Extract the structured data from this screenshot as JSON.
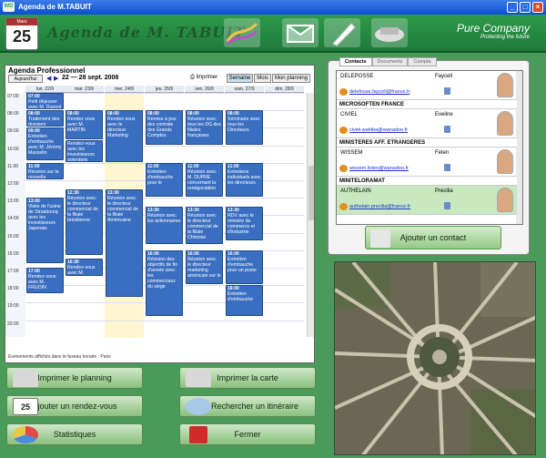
{
  "window": {
    "title": "Agenda de M.TABUIT",
    "icon_label": "WD"
  },
  "header": {
    "calendar_month": "Mars",
    "calendar_day": "25",
    "title": "Agenda de M. TABUIT",
    "brand": "Pure Company",
    "tagline": "Protecting the future"
  },
  "agenda": {
    "title": "Agenda Professionnel",
    "today_label": "Aujourd'hui",
    "range": "22 — 28 sept. 2008",
    "print_label": "Imprimer",
    "views": [
      "Semaine",
      "Mois",
      "Mon planning"
    ],
    "days": [
      "lun. 22/9",
      "mar. 23/9",
      "mer. 24/9",
      "jeu. 25/9",
      "ven. 26/9",
      "sam. 27/9",
      "dim. 28/9"
    ],
    "hours": [
      "07:00",
      "08:00",
      "09:00",
      "10:00",
      "11:00",
      "12:00",
      "13:00",
      "14:00",
      "15:00",
      "16:00",
      "17:00",
      "18:00",
      "19:00",
      "20:00"
    ],
    "events": [
      {
        "day": 0,
        "start": 7,
        "end": 8,
        "time": "07:00",
        "text": "Petit déjeuner avec M. Dupont"
      },
      {
        "day": 0,
        "start": 8,
        "end": 9,
        "time": "08:00",
        "text": "Traitement des dossiers"
      },
      {
        "day": 0,
        "start": 9,
        "end": 10.9,
        "time": "09:00",
        "text": "Entretien d'embauche avec M. Jérémy Masselin"
      },
      {
        "day": 0,
        "start": 11,
        "end": 12,
        "time": "11:00",
        "text": "Réunion sur la nouvelle"
      },
      {
        "day": 0,
        "start": 13,
        "end": 16.8,
        "time": "13:00",
        "text": "Visite de l'usine de Strasbourg avec les investisseurs Japonais"
      },
      {
        "day": 0,
        "start": 17,
        "end": 18.5,
        "time": "17:00",
        "text": "Rendez-vous avec M. FRUOIN"
      },
      {
        "day": 1,
        "start": 8,
        "end": 9.7,
        "time": "08:00",
        "text": "Rendez vous avec M. MARTIN"
      },
      {
        "day": 1,
        "start": 9.7,
        "end": 11,
        "time": "",
        "text": "Rendez-vous avec les investisseurs potentiels"
      },
      {
        "day": 1,
        "start": 12.5,
        "end": 16.3,
        "time": "12:30",
        "text": "Réunion avec le directeur commercial de la filiale brésilienne"
      },
      {
        "day": 1,
        "start": 16.5,
        "end": 17.5,
        "time": "16:30",
        "text": "Rendez-vous avec M."
      },
      {
        "day": 2,
        "start": 8,
        "end": 11,
        "time": "08:00",
        "text": "Rendez-vous avec le directeur Marketing"
      },
      {
        "day": 2,
        "start": 12.5,
        "end": 18.7,
        "time": "13:30",
        "text": "Réunion avec le directeur commercial de la filiale Américaine"
      },
      {
        "day": 3,
        "start": 8,
        "end": 10,
        "time": "08:00",
        "text": "Remise à jour des contrats des Grands Comptes"
      },
      {
        "day": 3,
        "start": 11,
        "end": 13,
        "time": "11:00",
        "text": "Entretien d'embauche pour le"
      },
      {
        "day": 3,
        "start": 13.5,
        "end": 15.7,
        "time": "13:30",
        "text": "Réunion avec les actionnaires"
      },
      {
        "day": 3,
        "start": 16,
        "end": 19.8,
        "time": "16:00",
        "text": "Révision des objectifs de fin d'année avec les commerciaux du siège"
      },
      {
        "day": 4,
        "start": 8,
        "end": 10,
        "time": "08:00",
        "text": "Réunion avec tous les DG des filiales françaises"
      },
      {
        "day": 4,
        "start": 11,
        "end": 13,
        "time": "11:00",
        "text": "Réunion avec M. DUPRE concernant la renégociation"
      },
      {
        "day": 4,
        "start": 13.5,
        "end": 15.7,
        "time": "13:30",
        "text": "Réunion avec le directeur commercial de la filiale Chinoise"
      },
      {
        "day": 4,
        "start": 16,
        "end": 18,
        "time": "16:00",
        "text": "Réunion avec le directeur marketing américain sur le"
      },
      {
        "day": 5,
        "start": 8,
        "end": 10,
        "time": "08:00",
        "text": "Séminaire avec tous les Directeurs"
      },
      {
        "day": 5,
        "start": 11,
        "end": 13,
        "time": "11:00",
        "text": "Entretiens individuels avec les directeurs"
      },
      {
        "day": 5,
        "start": 13.5,
        "end": 15.5,
        "time": "13:30",
        "text": "RDV avec le ministre du commerce et d'industrie"
      },
      {
        "day": 5,
        "start": 16,
        "end": 18,
        "time": "16:00",
        "text": "Entretien d'embauche pour un poste"
      },
      {
        "day": 5,
        "start": 18,
        "end": 19.8,
        "time": "18:00",
        "text": "Entretien d'embauche"
      }
    ],
    "timezone_note": "Evénements affichés dans le fuseau horaire : Paris"
  },
  "buttons": {
    "print_planning": "Imprimer le planning",
    "print_map": "Imprimer la carte",
    "add_appointment": "Ajouter un rendez-vous",
    "search_route": "Rechercher un itinéraire",
    "stats": "Statistiques",
    "close": "Fermer",
    "add_contact": "Ajouter un contact",
    "add_appt_icon_day": "25"
  },
  "contacts": {
    "tabs": [
      "Contacts",
      "Documents",
      "Compta"
    ],
    "rows": [
      {
        "org": "",
        "name": "DELEPOSSE",
        "first": "Faycell",
        "email": "delefosse.faycell@france.fr",
        "selected": false
      },
      {
        "org": "MICROSOFTEN FRANCE",
        "name": "CIVIEL",
        "first": "Eveline",
        "email": "civiel.wahiba@wanadoo.fr",
        "selected": false
      },
      {
        "org": "MINISTERES AFF. ETRANGERES",
        "name": "WISSEM",
        "first": "Feten",
        "email": "wissem.feten@wanadoo.fr",
        "selected": false
      },
      {
        "org": "MINITELORAMAT",
        "name": "AUTHELAIN",
        "first": "Precilia",
        "email": "authelain.precilia@france.fr",
        "selected": true
      }
    ]
  },
  "colors": {
    "accent": "#2e9a4a",
    "event": "#3a6ec0",
    "selected": "#c8e8c0"
  }
}
